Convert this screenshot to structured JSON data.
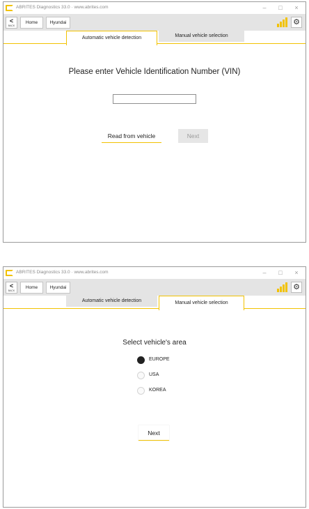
{
  "app": {
    "title": "ABRITES Diagnostics 33.0 · www.abrites.com",
    "window_controls": {
      "minimize": "–",
      "maximize": "□",
      "close": "×"
    },
    "brand_color": "#f2c200"
  },
  "toolbar": {
    "back_arrow": "<",
    "back_label": "BACK",
    "home_label": "Home",
    "brand_label": "Hyundai",
    "signal_icon": "signal-strength-icon",
    "settings_icon": "gear-icon",
    "settings_glyph": "⚙"
  },
  "tabs": [
    {
      "label": "Automatic vehicle detection"
    },
    {
      "label": "Manual vehicle selection"
    }
  ],
  "screen_vin": {
    "active_tab": 0,
    "heading": "Please enter Vehicle Identification Number (VIN)",
    "vin_value": "",
    "read_button": "Read from vehicle",
    "next_button": "Next",
    "next_enabled": false
  },
  "screen_area": {
    "active_tab": 1,
    "heading": "Select vehicle's area",
    "options": [
      {
        "label": "EUROPE",
        "selected": true
      },
      {
        "label": "USA",
        "selected": false
      },
      {
        "label": "KOREA",
        "selected": false
      }
    ],
    "next_button": "Next"
  }
}
